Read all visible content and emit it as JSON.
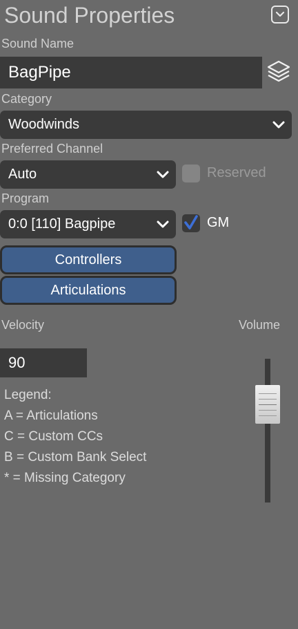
{
  "header": {
    "title": "Sound Properties",
    "collapse_icon": "chevron-down-icon"
  },
  "sound_name": {
    "label": "Sound Name",
    "value": "BagPipe",
    "layers_icon": "layers-icon"
  },
  "category": {
    "label": "Category",
    "selected": "Woodwinds"
  },
  "preferred_channel": {
    "label": "Preferred Channel",
    "selected": "Auto",
    "reserved_label": "Reserved",
    "reserved_checked": false
  },
  "program": {
    "label": "Program",
    "selected": "0:0 [110] Bagpipe",
    "gm_label": "GM",
    "gm_checked": true
  },
  "buttons": {
    "controllers": "Controllers",
    "articulations": "Articulations"
  },
  "velocity": {
    "label": "Velocity",
    "value": "90"
  },
  "volume": {
    "label": "Volume",
    "level": 0.8
  },
  "legend": {
    "title": "Legend:",
    "items": [
      "A = Articulations",
      "C = Custom CCs",
      "B = Custom Bank Select",
      "* = Missing Category"
    ]
  },
  "colors": {
    "background": "#6a6a6a",
    "field": "#3a3a3a",
    "button": "#3f5f8c",
    "check": "#3d6fd6"
  }
}
